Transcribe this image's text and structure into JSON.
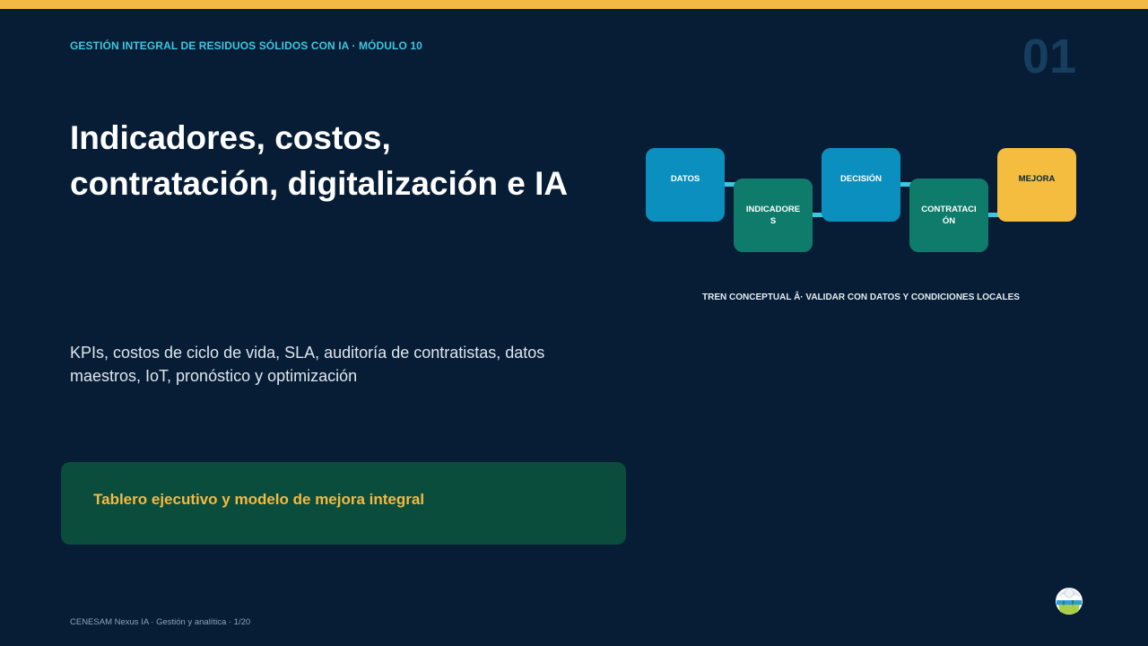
{
  "header": {
    "module_tag": "GESTIÓN INTEGRAL DE RESIDUOS SÓLIDOS CON IA · MÓDULO 10",
    "slide_number": "01"
  },
  "main": {
    "title_line1": "Indicadores, costos,",
    "title_line2": "contratación, digitalización e IA",
    "subtitle": "KPIs, costos de ciclo de vida, SLA, auditoría de contratistas, datos maestros, IoT, pronóstico y optimización",
    "callout": "Tablero ejecutivo y modelo de mejora integral"
  },
  "flow": {
    "steps": [
      "DATOS",
      "INDICADORES",
      "DECISIÓN",
      "CONTRATACIÓN",
      "MEJORA"
    ],
    "caption": "TREN CONCEPTUAL Â· VALIDAR CON DATOS Y CONDICIONES LOCALES"
  },
  "footer": {
    "text": "CENESAM Nexus IA · Gestión y analítica · 1/20"
  },
  "colors": {
    "background": "#061d35",
    "accent_yellow": "#f4b942",
    "accent_cyan": "#3fc6e0",
    "box_blue": "#0b8fbf",
    "box_green": "#0f7b6b",
    "callout_bg": "#0b4d3d"
  },
  "icons": {
    "logo": "organization-logo-icon"
  }
}
